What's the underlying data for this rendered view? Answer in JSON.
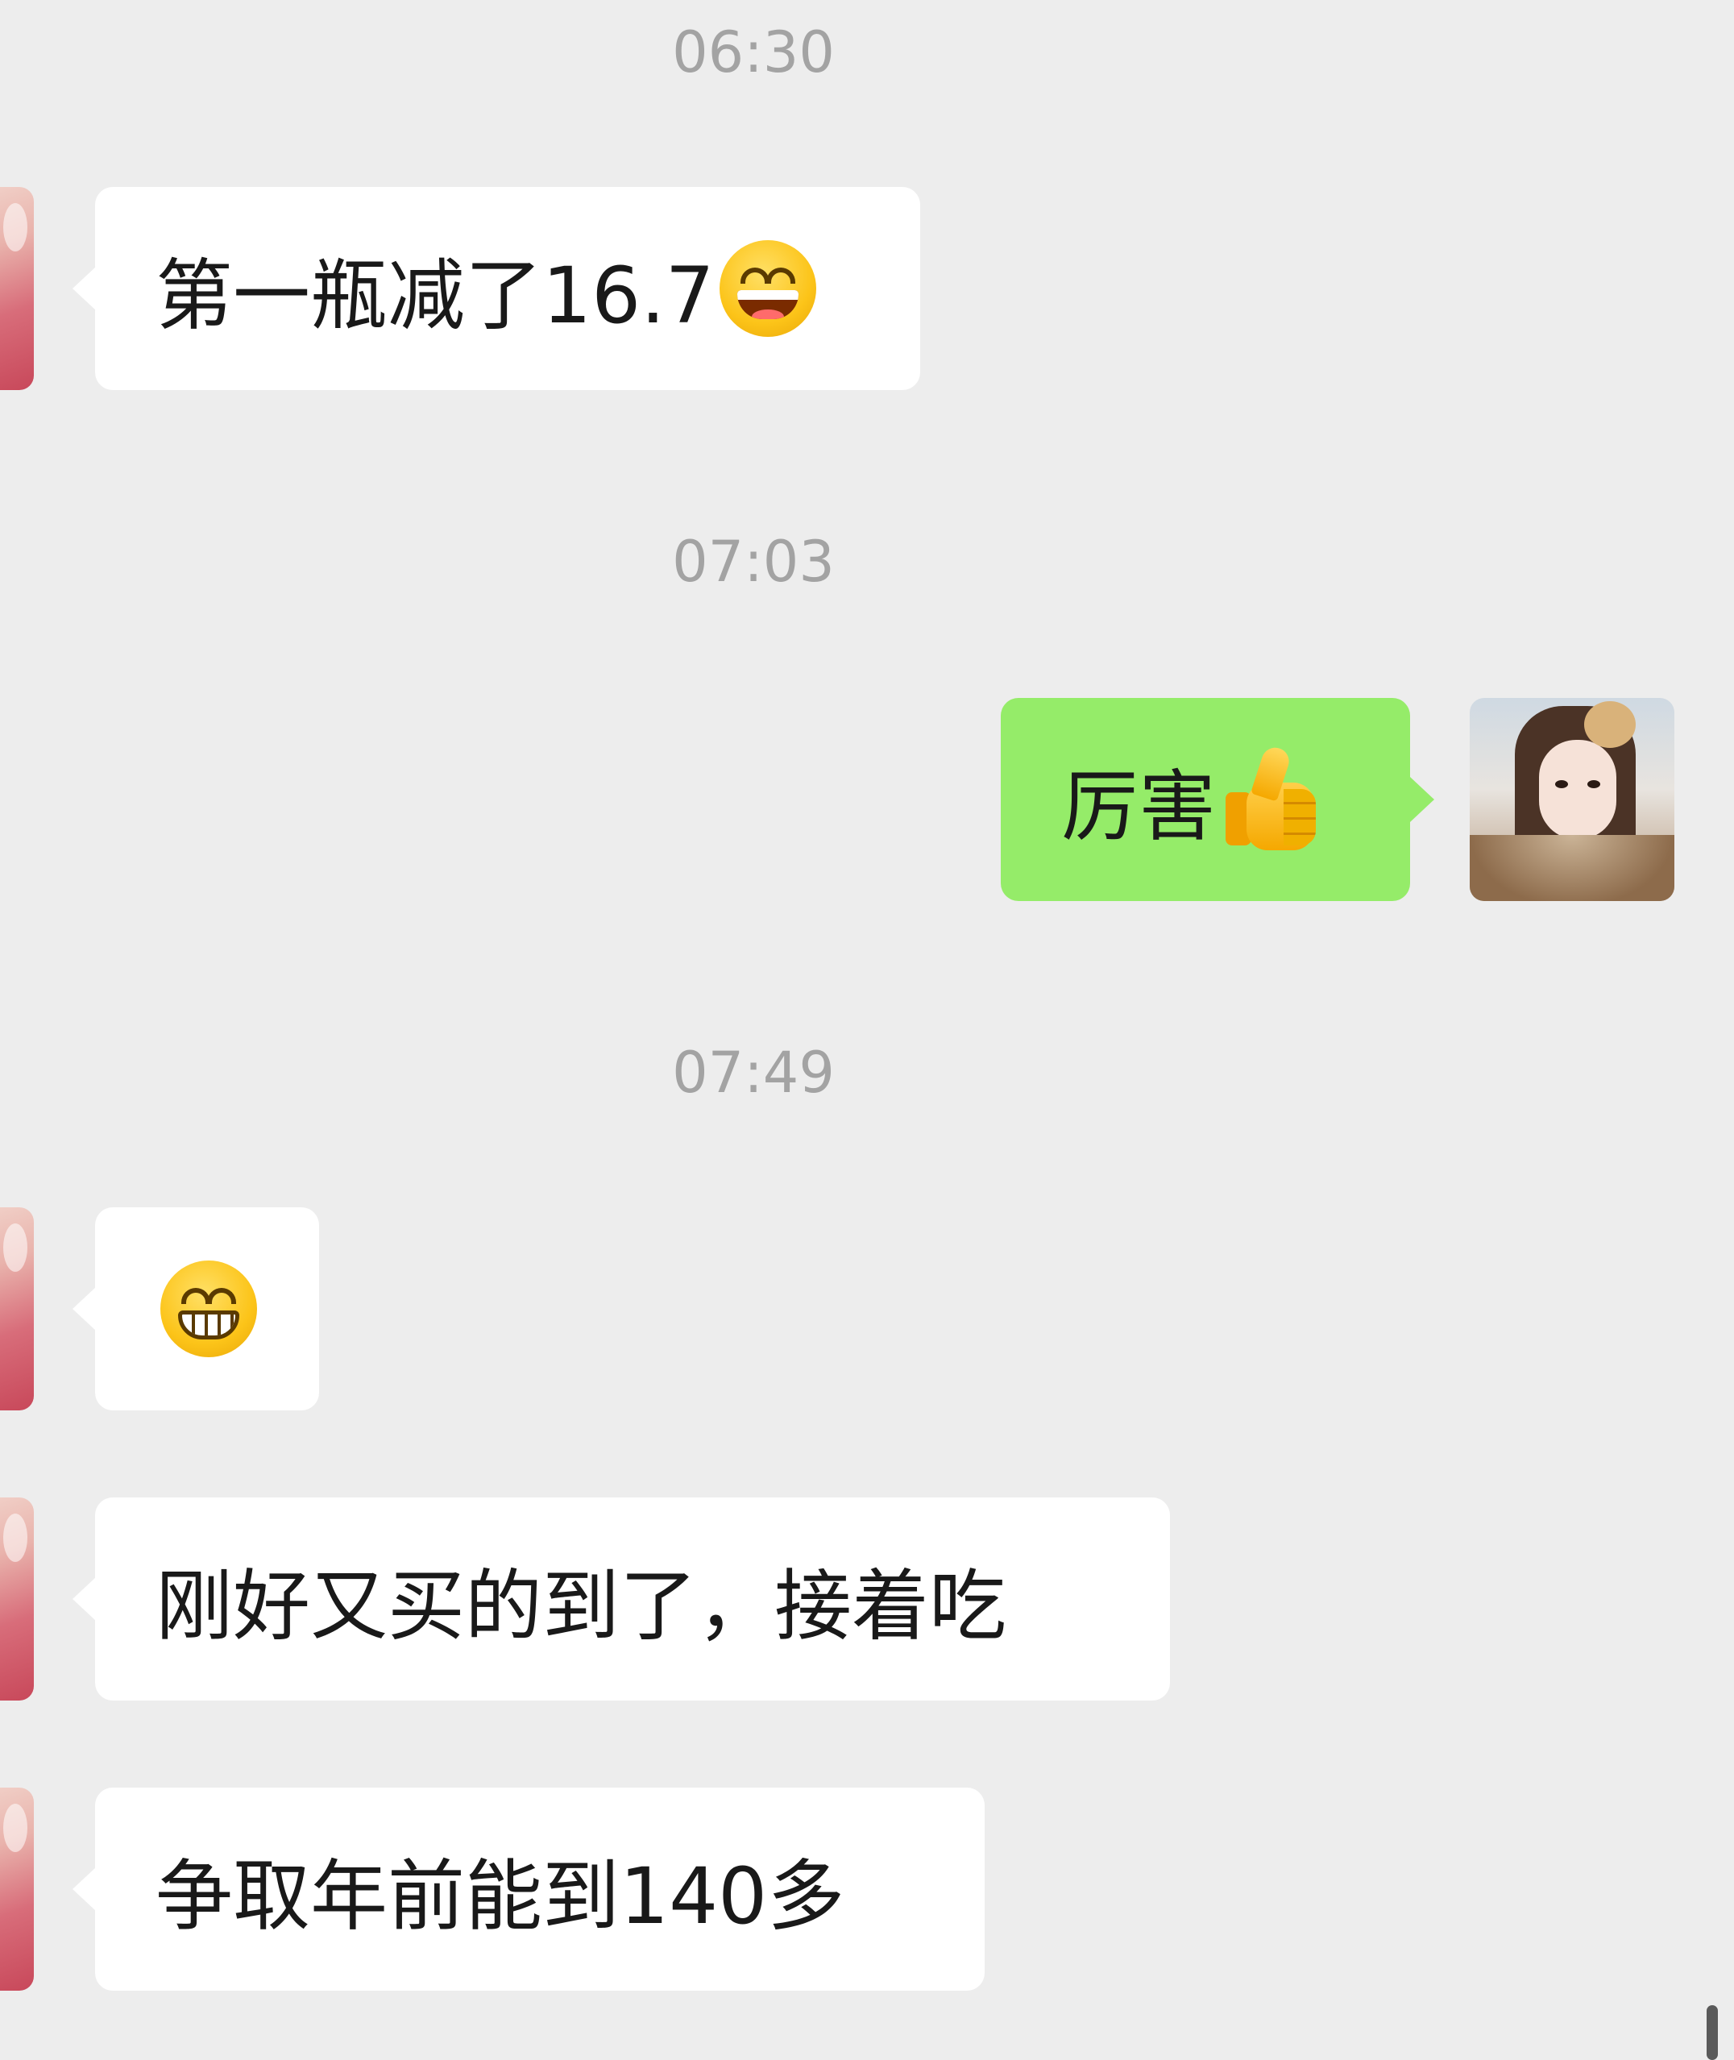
{
  "chat": {
    "timestamps": [
      "06:30",
      "07:03",
      "07:49"
    ],
    "messages": [
      {
        "sender": "contact",
        "text": "第一瓶减了16.7",
        "emoji": "smile-emoji"
      },
      {
        "sender": "me",
        "text": "厉害",
        "emoji": "thumbs-up-emoji"
      },
      {
        "sender": "contact",
        "text": "",
        "emoji": "grin-emoji"
      },
      {
        "sender": "contact",
        "text": "刚好又买的到了，接着吃"
      },
      {
        "sender": "contact",
        "text": "争取年前能到140多"
      }
    ]
  },
  "colors": {
    "background": "#ededed",
    "incoming_bubble": "#ffffff",
    "outgoing_bubble": "#95ec69",
    "timestamp": "#a3a3a3",
    "text": "#191919"
  }
}
